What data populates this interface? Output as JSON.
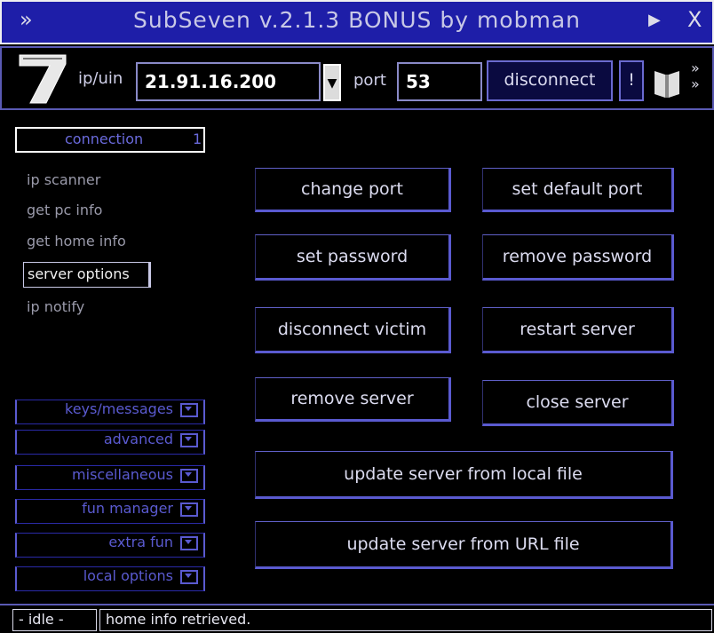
{
  "window": {
    "title": "SubSeven v.2.1.3 BONUS by mobman",
    "menu_glyph": "»",
    "pin_glyph": "▶",
    "close_glyph": "X"
  },
  "toolbar": {
    "logo_text": "7",
    "ip_label": "ip/uin",
    "ip_value": "21.91.16.200",
    "port_label": "port",
    "port_value": "53",
    "connect_label": "disconnect",
    "bang_label": "!",
    "more_glyph": "»"
  },
  "nav": {
    "selector_label": "connection",
    "selector_count": "1",
    "items": [
      {
        "label": "ip scanner"
      },
      {
        "label": "get pc info"
      },
      {
        "label": "get home info"
      },
      {
        "label": "server options",
        "active": true
      },
      {
        "label": "ip notify"
      }
    ],
    "groups": [
      {
        "label": "keys/messages"
      },
      {
        "label": "advanced"
      },
      {
        "label": "miscellaneous"
      },
      {
        "label": "fun manager"
      },
      {
        "label": "extra fun"
      },
      {
        "label": "local options"
      }
    ]
  },
  "actions": {
    "change_port": "change port",
    "set_default_port": "set default port",
    "set_password": "set password",
    "remove_password": "remove password",
    "disconnect_victim": "disconnect victim",
    "restart_server": "restart server",
    "remove_server": "remove server",
    "close_server": "close server",
    "update_local": "update server from local file",
    "update_url": "update server from URL file"
  },
  "status": {
    "tag": "- idle -",
    "message": "home info retrieved."
  },
  "colors": {
    "titlebar_bg": "#1e1ea8",
    "accent": "#5a5ad0",
    "background": "#000000"
  }
}
